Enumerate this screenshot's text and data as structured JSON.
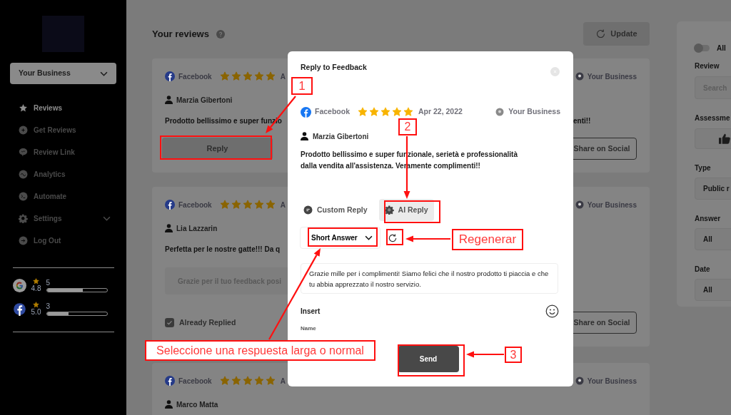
{
  "sidebar": {
    "business_select": "Your Business",
    "nav": [
      {
        "label": "Reviews",
        "kind": "star",
        "selected": true
      },
      {
        "label": "Get Reviews",
        "kind": "plus",
        "selected": false
      },
      {
        "label": "Review Link",
        "kind": "chat",
        "selected": false
      },
      {
        "label": "Analytics",
        "kind": "wave",
        "selected": false
      },
      {
        "label": "Automate",
        "kind": "terminal",
        "selected": false
      },
      {
        "label": "Settings",
        "kind": "gear",
        "selected": false,
        "expandable": true
      },
      {
        "label": "Log Out",
        "kind": "arrow",
        "selected": false
      }
    ],
    "platform_ratings": [
      {
        "kind": "google",
        "rating": "4.8",
        "count": "5",
        "level": 0.6
      },
      {
        "kind": "facebook",
        "rating": "5.0",
        "count": "3",
        "level": 0.36
      }
    ]
  },
  "header": {
    "title": "Your reviews",
    "update_button": "Update"
  },
  "reviews": [
    {
      "kind": "unreplied",
      "platform": "Facebook",
      "stars": 5,
      "date": "A",
      "business": "Your Business",
      "author": "Marzia Gibertoni",
      "text_start": "Prodotto bellissimo e super funzio",
      "text_end": "enti!!",
      "reply_button": "Reply",
      "share_button": "Share on Social"
    },
    {
      "kind": "replied",
      "platform": "Facebook",
      "stars": 5,
      "date": "A",
      "business": "Your Business",
      "author": "Lia Lazzarin",
      "text_start": "Perfetta per le nostre gatte!!! Da q",
      "reply_preview": "Grazie per il tuo feedback posi",
      "status": "Already Replied",
      "share_button": "Share on Social"
    },
    {
      "kind": "partial",
      "platform": "Facebook",
      "stars": 5,
      "date": "A",
      "business": "Your Business",
      "author": "Marco Matta"
    }
  ],
  "filters": {
    "toggle": {
      "label": "All",
      "on": false
    },
    "review": {
      "label": "Review",
      "placeholder": "Search"
    },
    "assessment": {
      "label": "Assessme"
    },
    "type": {
      "label": "Type",
      "value": "Public r"
    },
    "answer": {
      "label": "Answer",
      "value": "All"
    },
    "date": {
      "label": "Date",
      "value": "All"
    }
  },
  "modal": {
    "title": "Reply to Feedback",
    "platform": "Facebook",
    "stars": 5,
    "date": "Apr 22, 2022",
    "business": "Your Business",
    "author": "Marzia Gibertoni",
    "text": "Prodotto bellissimo e super funzionale, serietà e professionalità dalla vendita all'assistenza. Veramente complimenti!!",
    "tabs": [
      {
        "label": "Custom Reply",
        "selected": false
      },
      {
        "label": "AI Reply",
        "selected": true
      }
    ],
    "length_select": "Short Answer",
    "reply_text": "Grazie mille per i complimenti! Siamo felici che il nostro prodotto ti piaccia e che tu abbia apprezzato il nostro servizio.",
    "insert_label": "Insert",
    "name_label": "Name",
    "send_button": "Send"
  },
  "annotations": [
    {
      "text": "1"
    },
    {
      "text": "2"
    },
    {
      "text": "Regenerar"
    },
    {
      "text": "Seleccione una respuesta larga o normal"
    },
    {
      "text": "3"
    }
  ]
}
